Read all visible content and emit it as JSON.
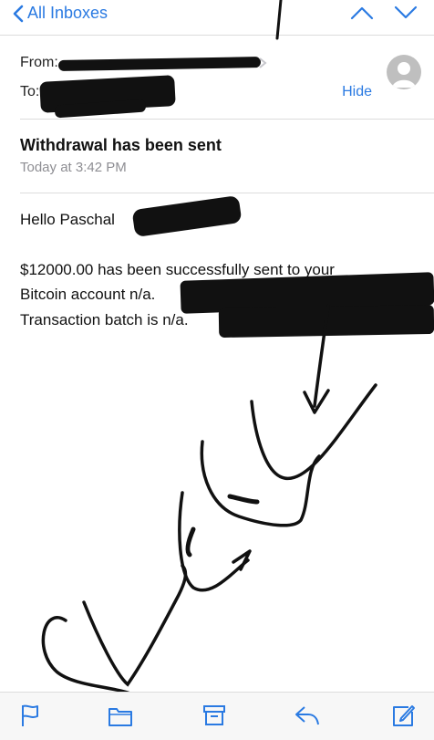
{
  "navbar": {
    "back_label": "All Inboxes",
    "back_icon": "chevron-left-icon",
    "prev_icon": "chevron-up-icon",
    "next_icon": "chevron-down-icon",
    "accent_color": "#2a7ae2"
  },
  "header": {
    "from_label": "From:",
    "to_label": "To:",
    "hide_label": "Hide"
  },
  "message": {
    "subject": "Withdrawal has been sent",
    "timestamp": "Today at 3:42 PM",
    "greeting": "Hello Paschal",
    "line1": "$12000.00 has been successfully sent to your",
    "line2": "Bitcoin account n/a.",
    "line3": "Transaction batch is n/a."
  },
  "toolbar": {
    "icons": [
      "flag-icon",
      "folder-icon",
      "archive-icon",
      "reply-icon",
      "compose-icon"
    ]
  }
}
